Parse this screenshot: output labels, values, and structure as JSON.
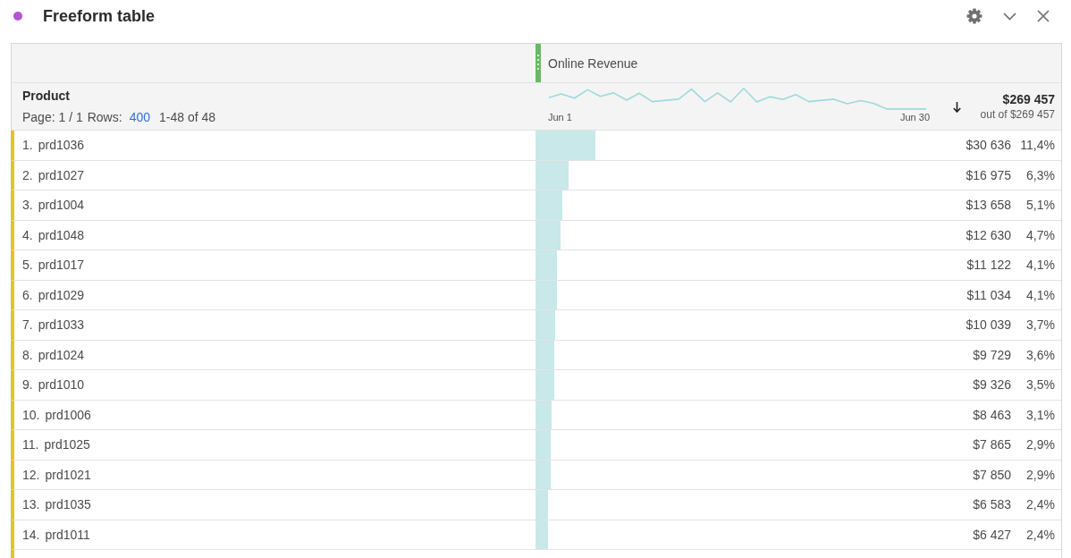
{
  "panel": {
    "title": "Freeform table"
  },
  "table": {
    "dimension": {
      "name": "Product",
      "page_info": "Page: 1 / 1",
      "rows_label": "Rows:",
      "rows_per_page": "400",
      "range": "1-48 of 48"
    },
    "metric": {
      "name": "Online Revenue",
      "trend_start": "Jun 1",
      "trend_end": "Jun 30",
      "sorted_descending": true,
      "total": "$269 457",
      "total_of": "out of $269 457"
    },
    "rows": [
      {
        "index": "1.",
        "name": "prd1036",
        "value": "$30 636",
        "percent": "11,4%"
      },
      {
        "index": "2.",
        "name": "prd1027",
        "value": "$16 975",
        "percent": "6,3%"
      },
      {
        "index": "3.",
        "name": "prd1004",
        "value": "$13 658",
        "percent": "5,1%"
      },
      {
        "index": "4.",
        "name": "prd1048",
        "value": "$12 630",
        "percent": "4,7%"
      },
      {
        "index": "5.",
        "name": "prd1017",
        "value": "$11 122",
        "percent": "4,1%"
      },
      {
        "index": "6.",
        "name": "prd1029",
        "value": "$11 034",
        "percent": "4,1%"
      },
      {
        "index": "7.",
        "name": "prd1033",
        "value": "$10 039",
        "percent": "3,7%"
      },
      {
        "index": "8.",
        "name": "prd1024",
        "value": "$9 729",
        "percent": "3,6%"
      },
      {
        "index": "9.",
        "name": "prd1010",
        "value": "$9 326",
        "percent": "3,5%"
      },
      {
        "index": "10.",
        "name": "prd1006",
        "value": "$8 463",
        "percent": "3,1%"
      },
      {
        "index": "11.",
        "name": "prd1025",
        "value": "$7 865",
        "percent": "2,9%"
      },
      {
        "index": "12.",
        "name": "prd1021",
        "value": "$7 850",
        "percent": "2,9%"
      },
      {
        "index": "13.",
        "name": "prd1035",
        "value": "$6 583",
        "percent": "2,4%"
      },
      {
        "index": "14.",
        "name": "prd1011",
        "value": "$6 427",
        "percent": "2,4%"
      }
    ]
  }
}
